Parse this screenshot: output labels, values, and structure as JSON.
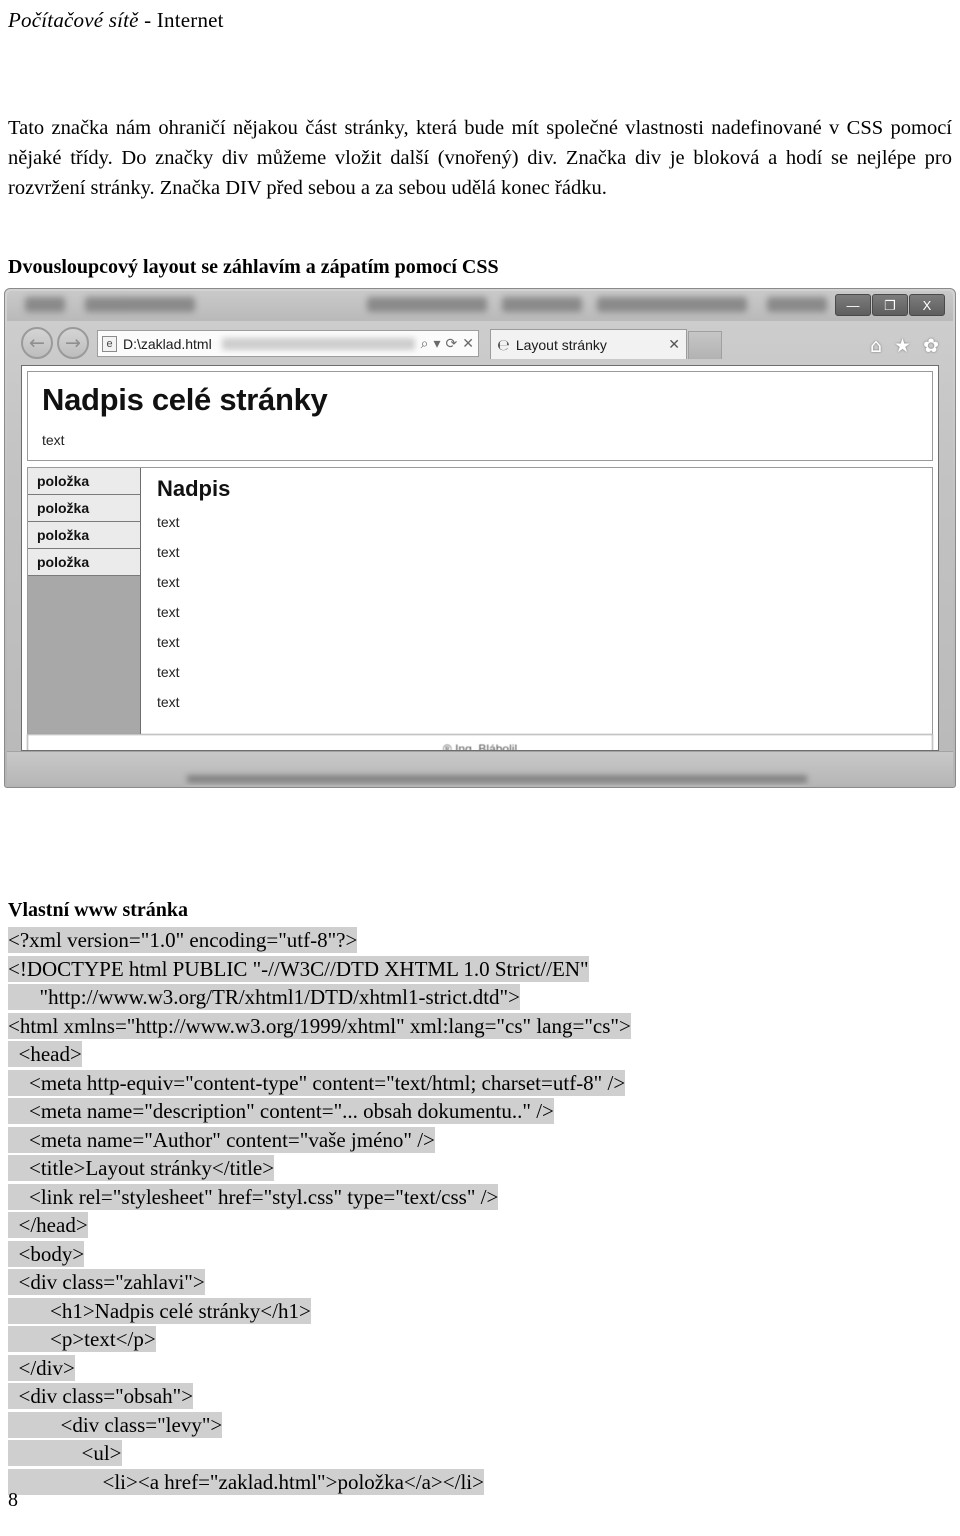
{
  "running_head": {
    "italic_part": "Počítačové sítě",
    "plain_part": " - Internet"
  },
  "paragraph": "Tato značka nám ohraničí nějakou část stránky, která bude mít společné vlastnosti nadefinované v CSS pomocí nějaké třídy. Do značky div můžeme vložit další (vnořený) div. Značka div je bloková a hodí se nejlépe pro rozvržení stránky. Značka DIV před sebou a za sebou udělá konec řádku.",
  "headings": {
    "layout": "Dvousloupcový layout se záhlavím a zápatím pomocí CSS",
    "vlastni": "Vlastní www stránka"
  },
  "browser": {
    "window_buttons": {
      "minimize": "—",
      "maximize": "❐",
      "close": "X"
    },
    "nav": {
      "back": "←",
      "forward": "→"
    },
    "address": {
      "favicon": "e",
      "value": "D:\\zaklad.html",
      "search_icon": "⌕",
      "search_dropdown": "▾",
      "refresh_icon": "⟳",
      "stop_icon": "✕"
    },
    "tab": {
      "favicon": "℮",
      "title": "Layout stránky",
      "close": "✕"
    },
    "toolbar_icons": {
      "home": "⌂",
      "favorites": "★",
      "settings": "✿"
    },
    "page": {
      "h1": "Nadpis celé stránky",
      "header_text": "text",
      "menu_items": [
        "položka",
        "položka",
        "položka",
        "položka"
      ],
      "content_h2": "Nadpis",
      "content_lines": [
        "text",
        "text",
        "text",
        "text",
        "text",
        "text",
        "text"
      ],
      "footer": "® Ing. Blábolil"
    }
  },
  "code": {
    "lines": [
      {
        "indent": 0,
        "text": "<?xml version=\"1.0\" encoding=\"utf-8\"?>"
      },
      {
        "indent": 0,
        "text": "<!DOCTYPE html PUBLIC \"-//W3C//DTD XHTML 1.0 Strict//EN\""
      },
      {
        "indent": 3,
        "text": "\"http://www.w3.org/TR/xhtml1/DTD/xhtml1-strict.dtd\">"
      },
      {
        "indent": 0,
        "text": "<html xmlns=\"http://www.w3.org/1999/xhtml\" xml:lang=\"cs\" lang=\"cs\">"
      },
      {
        "indent": 1,
        "text": "<head>"
      },
      {
        "indent": 2,
        "text": "<meta http-equiv=\"content-type\" content=\"text/html; charset=utf-8\" />"
      },
      {
        "indent": 2,
        "text": "<meta name=\"description\" content=\"... obsah dokumentu..\" />"
      },
      {
        "indent": 2,
        "text": "<meta name=\"Author\" content=\"vaše jméno\" />"
      },
      {
        "indent": 2,
        "text": "<title>Layout stránky</title>"
      },
      {
        "indent": 2,
        "text": "<link rel=\"stylesheet\" href=\"styl.css\" type=\"text/css\" />"
      },
      {
        "indent": 1,
        "text": "</head>"
      },
      {
        "indent": 1,
        "text": "<body>"
      },
      {
        "indent": 1,
        "text": "<div class=\"zahlavi\">"
      },
      {
        "indent": 4,
        "text": "<h1>Nadpis celé stránky</h1>"
      },
      {
        "indent": 4,
        "text": "<p>text</p>"
      },
      {
        "indent": 1,
        "text": "</div>"
      },
      {
        "indent": 1,
        "text": "<div class=\"obsah\">"
      },
      {
        "indent": 5,
        "text": "<div class=\"levy\">"
      },
      {
        "indent": 7,
        "text": "<ul>"
      },
      {
        "indent": 9,
        "text": "<li><a href=\"zaklad.html\">položka</a></li>"
      }
    ]
  },
  "page_number": "8"
}
